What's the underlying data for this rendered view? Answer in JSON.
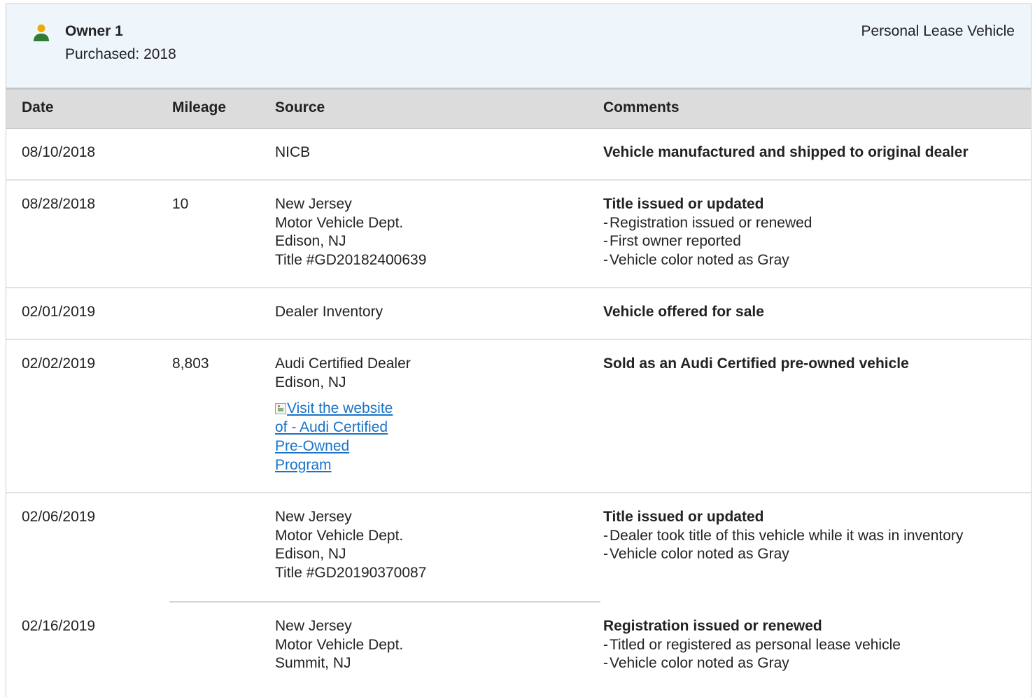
{
  "owner": {
    "title": "Owner 1",
    "purchased": "Purchased: 2018",
    "type": "Personal Lease Vehicle",
    "icon": "person-icon",
    "icon_colors": {
      "head": "#f0a900",
      "body": "#2e7d32"
    }
  },
  "table": {
    "headers": {
      "date": "Date",
      "mileage": "Mileage",
      "source": "Source",
      "comments": "Comments"
    },
    "rows": [
      {
        "date": "08/10/2018",
        "mileage": "",
        "source": [
          "NICB"
        ],
        "comment_title": "Vehicle manufactured and shipped to original dealer",
        "comment_items": []
      },
      {
        "date": "08/28/2018",
        "mileage": "10",
        "source": [
          "New Jersey",
          "Motor Vehicle Dept.",
          "Edison, NJ",
          "Title #GD20182400639"
        ],
        "comment_title": "Title issued or updated",
        "comment_items": [
          "Registration issued or renewed",
          "First owner reported",
          "Vehicle color noted as Gray"
        ]
      },
      {
        "date": "02/01/2019",
        "mileage": "",
        "source": [
          "Dealer Inventory"
        ],
        "comment_title": "Vehicle offered for sale",
        "comment_items": []
      },
      {
        "date": "02/02/2019",
        "mileage": "8,803",
        "source": [
          "Audi Certified Dealer",
          "Edison, NJ"
        ],
        "source_link": "Visit the website of - Audi Certified Pre-Owned Program",
        "comment_title": "Sold as an Audi Certified pre-owned vehicle",
        "comment_items": []
      },
      {
        "date": "02/06/2019",
        "mileage": "",
        "source": [
          "New Jersey",
          "Motor Vehicle Dept.",
          "Edison, NJ",
          "Title #GD20190370087"
        ],
        "comment_title": "Title issued or updated",
        "comment_items": [
          "Dealer took title of this vehicle while it was in inventory",
          "Vehicle color noted as Gray"
        ]
      },
      {
        "date": "02/16/2019",
        "mileage": "",
        "source": [
          "New Jersey",
          "Motor Vehicle Dept.",
          "Summit, NJ"
        ],
        "comment_title": "Registration issued or renewed",
        "comment_items": [
          "Titled or registered as personal lease vehicle",
          "Vehicle color noted as Gray"
        ]
      }
    ]
  },
  "colors": {
    "header_bg": "#eef5fb",
    "table_head_bg": "#dcdcdc",
    "link": "#1a73c8"
  }
}
